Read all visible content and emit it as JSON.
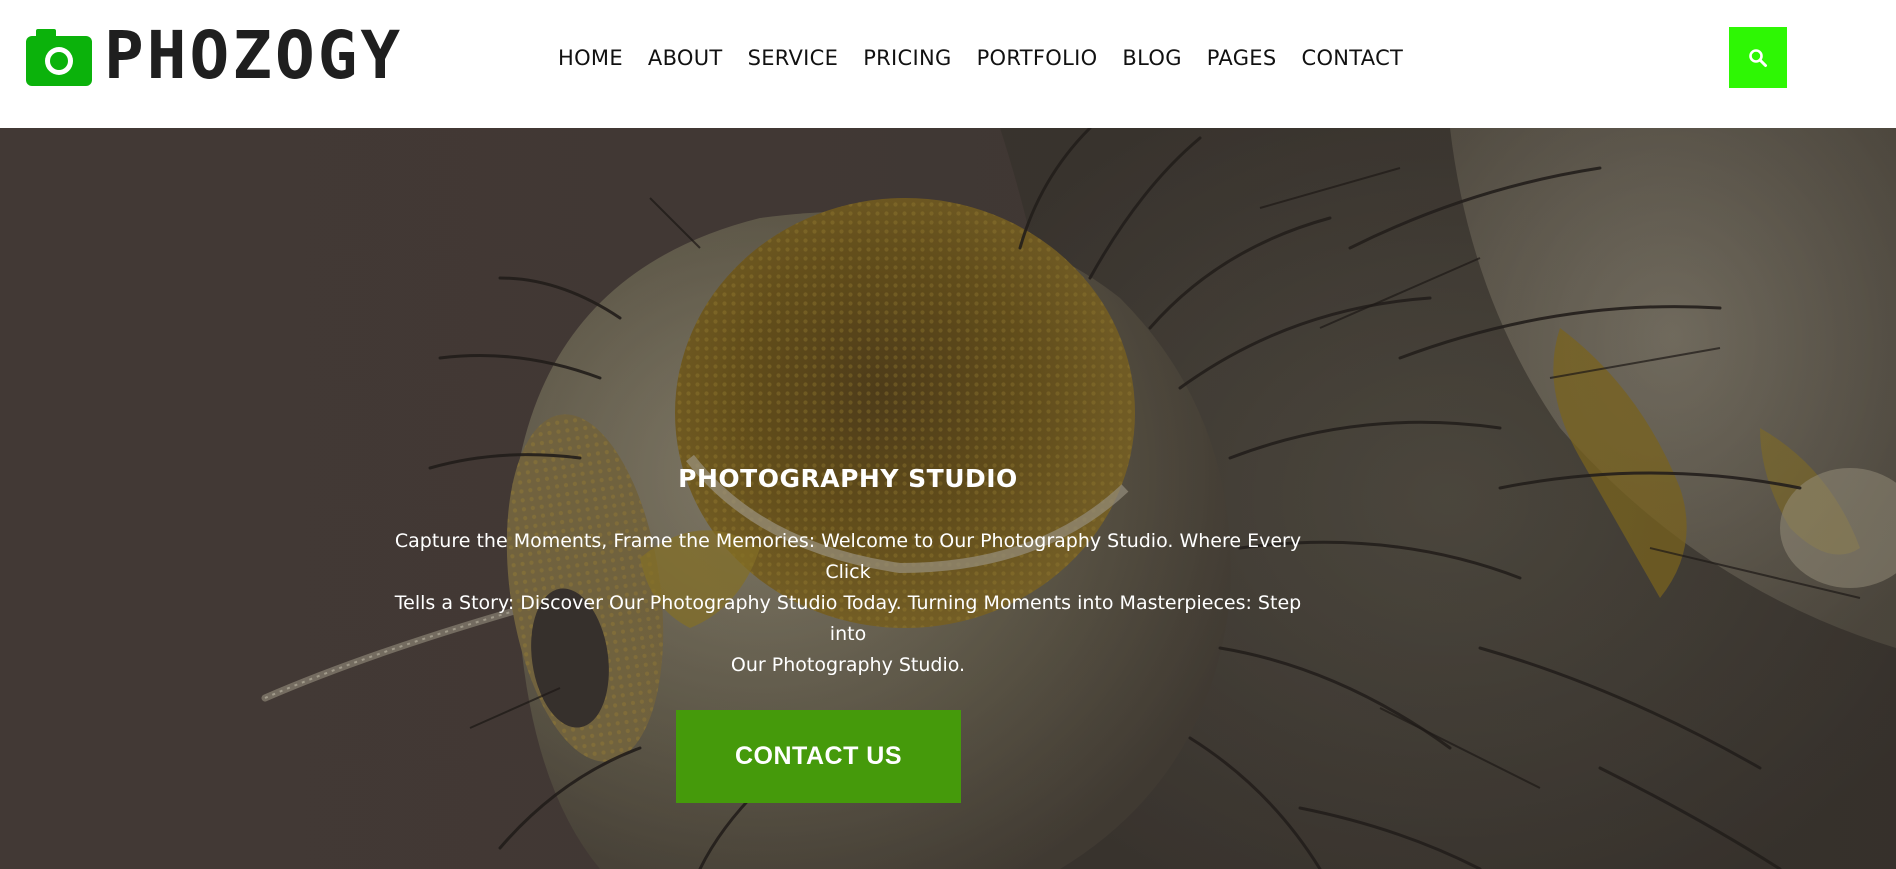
{
  "brand": {
    "name": "PHOZOGY",
    "icon": "camera-icon",
    "accent_color": "#0bb20b"
  },
  "nav": {
    "items": [
      {
        "label": "HOME"
      },
      {
        "label": "ABOUT"
      },
      {
        "label": "SERVICE"
      },
      {
        "label": "PRICING"
      },
      {
        "label": "PORTFOLIO"
      },
      {
        "label": "BLOG"
      },
      {
        "label": "PAGES"
      },
      {
        "label": "CONTACT"
      }
    ],
    "search_icon": "search-icon",
    "search_button_color": "#2ef704"
  },
  "hero": {
    "background": "macro photograph of a fly's compound eye",
    "title": "PHOTOGRAPHY STUDIO",
    "text_line1": "Capture the Moments, Frame the Memories: Welcome to Our Photography Studio. Where Every Click",
    "text_line2": "Tells a Story: Discover Our Photography Studio Today. Turning Moments into Masterpieces: Step into",
    "text_line3": "Our Photography Studio.",
    "cta_label": "CONTACT US",
    "cta_color": "#459a0b"
  }
}
